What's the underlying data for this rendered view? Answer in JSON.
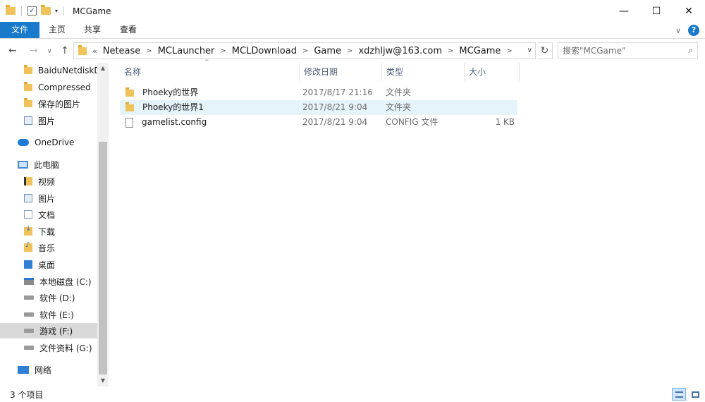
{
  "window": {
    "title": "MCGame",
    "minimize_glyph": "—",
    "maximize_glyph": "☐",
    "close_glyph": "✕"
  },
  "ribbon": {
    "tabs": [
      "文件",
      "主页",
      "共享",
      "查看"
    ],
    "expand_glyph": "∨",
    "help_glyph": "?"
  },
  "address": {
    "lead": "«",
    "crumbs": [
      "Netease",
      "MCLauncher",
      "MCLDownload",
      "Game",
      "xdzhljw@163.com",
      "MCGame"
    ],
    "separator": ">",
    "dropdown_glyph": "∨",
    "refresh_glyph": "↻"
  },
  "search": {
    "placeholder": "搜索\"MCGame\""
  },
  "nav": {
    "back_glyph": "←",
    "forward_glyph": "→",
    "recent_glyph": "∨",
    "up_glyph": "↑",
    "items": [
      {
        "label": "BaiduNetdiskDo",
        "icon": "folder-icon"
      },
      {
        "label": "Compressed",
        "icon": "folder-icon"
      },
      {
        "label": "保存的图片",
        "icon": "folder-icon"
      },
      {
        "label": "图片",
        "icon": "pictures-icon"
      },
      {
        "label": "OneDrive",
        "icon": "onedrive-icon"
      },
      {
        "label": "此电脑",
        "icon": "this-pc-icon"
      },
      {
        "label": "视频",
        "icon": "videos-icon"
      },
      {
        "label": "图片",
        "icon": "pictures-icon"
      },
      {
        "label": "文档",
        "icon": "documents-icon"
      },
      {
        "label": "下载",
        "icon": "downloads-icon"
      },
      {
        "label": "音乐",
        "icon": "music-icon"
      },
      {
        "label": "桌面",
        "icon": "desktop-icon"
      },
      {
        "label": "本地磁盘 (C:)",
        "icon": "system-drive-icon"
      },
      {
        "label": "软件 (D:)",
        "icon": "drive-icon"
      },
      {
        "label": "软件 (E:)",
        "icon": "drive-icon"
      },
      {
        "label": "游戏 (F:)",
        "icon": "drive-icon"
      },
      {
        "label": "文件资料 (G:)",
        "icon": "drive-icon"
      },
      {
        "label": "网络",
        "icon": "network-icon"
      }
    ],
    "selected": "游戏 (F:)"
  },
  "columns": [
    "名称",
    "修改日期",
    "类型",
    "大小"
  ],
  "files": [
    {
      "name": "Phoeky的世界",
      "date": "2017/8/17 21:16",
      "type": "文件夹",
      "size": "",
      "kind": "folder"
    },
    {
      "name": "Phoeky的世界1",
      "date": "2017/8/21 9:04",
      "type": "文件夹",
      "size": "",
      "kind": "folder"
    },
    {
      "name": "gamelist.config",
      "date": "2017/8/21 9:04",
      "type": "CONFIG 文件",
      "size": "1 KB",
      "kind": "file"
    }
  ],
  "status": {
    "item_count": "3 个项目"
  },
  "colors": {
    "accent": "#1979ca",
    "hover_row": "#e5f3fb",
    "selected_nav": "#d9d9d9",
    "folder": "#f0c35a"
  }
}
